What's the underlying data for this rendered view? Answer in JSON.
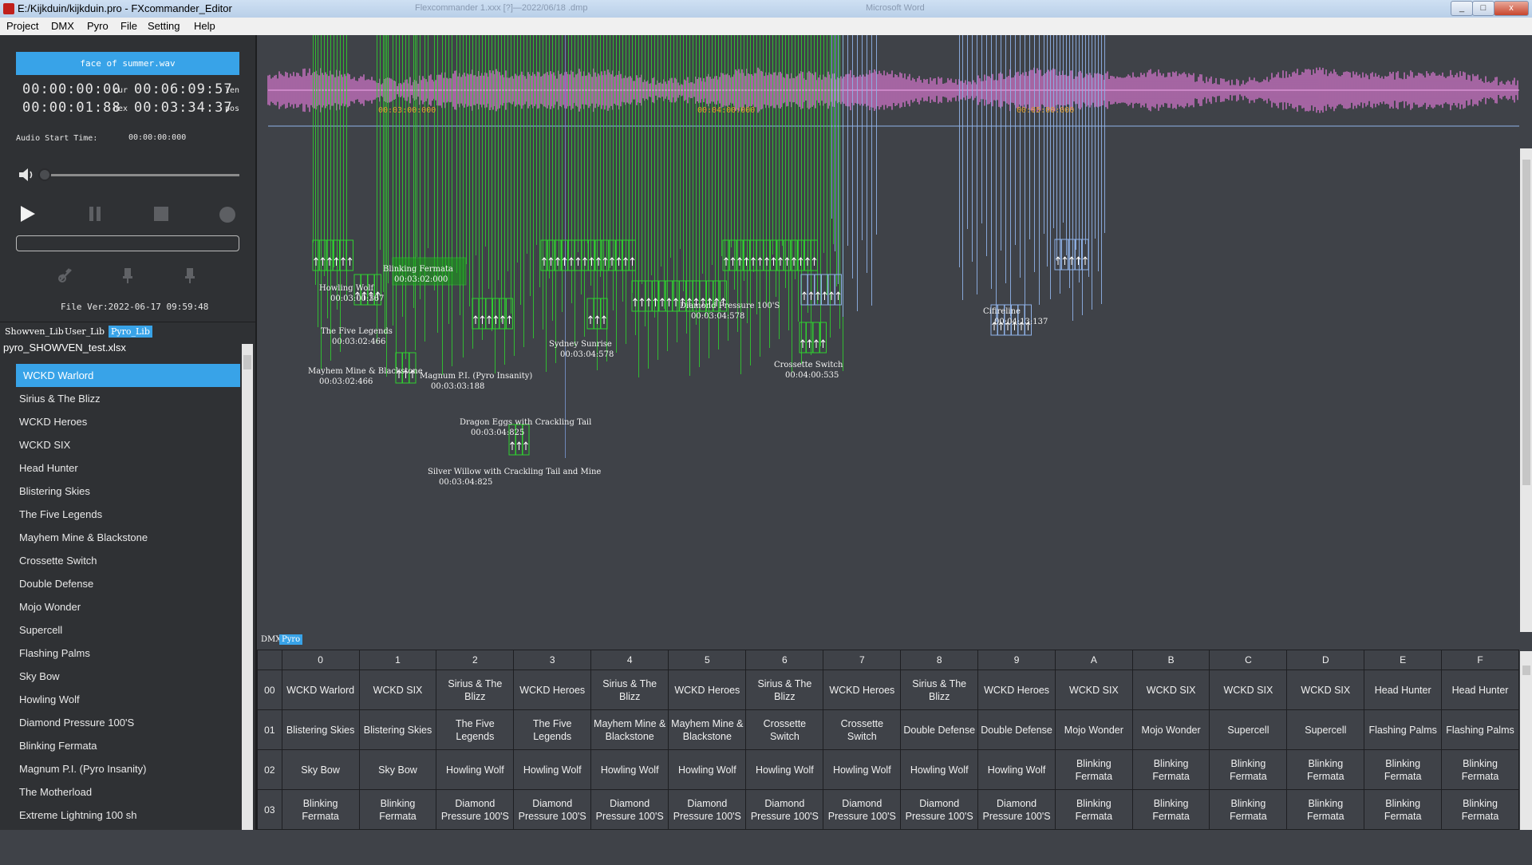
{
  "window": {
    "title": "E:/Kijkduin/kijkduin.pro - FXcommander_Editor",
    "ghost_titles": [
      "Flexcommander 1.xxx [?]—2022/06/18 .dmp",
      "Microsoft Word"
    ],
    "controls": [
      "_",
      "□",
      "x"
    ]
  },
  "menu": [
    "Project",
    "DMX",
    "Pyro",
    "File",
    "Setting",
    "Help"
  ],
  "player": {
    "audio_file": "face of summer.wav",
    "timecodes": [
      {
        "left": "00:00:00:00",
        "label_mid": "cur",
        "right": "00:06:09:57",
        "label_right": "len"
      },
      {
        "left": "00:00:01:88",
        "label_mid": "nex",
        "right": "00:03:34:37",
        "label_right": "pos"
      }
    ],
    "audio_start_label": "Audio Start Time:",
    "audio_start_value": "00:00:00:000",
    "volume": 0.0,
    "file_version": "File Ver:2022-06-17 09:59:48"
  },
  "library": {
    "tabs": [
      "Showven_Lib",
      "User_Lib",
      "Pyro_Lib"
    ],
    "active_tab": "Pyro_Lib",
    "file": "pyro_SHOWVEN_test.xlsx",
    "items": [
      "WCKD Warlord",
      "Sirius & The Blizz",
      "WCKD Heroes",
      "WCKD SIX",
      "Head Hunter",
      "Blistering Skies",
      "The Five Legends",
      "Mayhem Mine & Blackstone",
      "Crossette Switch",
      "Double Defense",
      "Mojo Wonder",
      "Supercell",
      "Flashing Palms",
      "Sky Bow",
      "Howling Wolf",
      "Diamond Pressure 100'S",
      "Blinking Fermata",
      "Magnum P.I. (Pyro Insanity)",
      "The Motherload",
      "Extreme Lightning 100 sh"
    ],
    "selected": "WCKD Warlord"
  },
  "timeline": {
    "markers": [
      "00:03:00:000",
      "00:04:00:000",
      "00:05:00:000"
    ],
    "labels": [
      {
        "text": "Blinking Fermata",
        "time": "00:03:02:000"
      },
      {
        "text": "Howling Wolf",
        "time": "00:03:00:367"
      },
      {
        "text": "The Five Legends",
        "time": "00:03:02:466"
      },
      {
        "text": "Mayhem Mine & Blackstone",
        "time": "00:03:02:466"
      },
      {
        "text": "Magnum P.I. (Pyro Insanity)",
        "time": "00:03:03:188"
      },
      {
        "text": "Dragon Eggs with Crackling Tail",
        "time": "00:03:04:825"
      },
      {
        "text": "Silver Willow with Crackling Tail and Mine",
        "time": "00:03:04:825"
      },
      {
        "text": "Sydney Sunrise",
        "time": "00:03:04:578"
      },
      {
        "text": "Diamond Pressure 100'S",
        "time": "00:03:04:578"
      },
      {
        "text": "Crossette Switch",
        "time": "00:04:00:535"
      },
      {
        "text": "Cifireline",
        "time": "00:04:13:137"
      }
    ]
  },
  "grid": {
    "tabs": [
      "DMX",
      "Pyro"
    ],
    "active_tab": "Pyro",
    "columns": [
      "0",
      "1",
      "2",
      "3",
      "4",
      "5",
      "6",
      "7",
      "8",
      "9",
      "A",
      "B",
      "C",
      "D",
      "E",
      "F"
    ],
    "rows": [
      {
        "id": "00",
        "cells": [
          "WCKD Warlord",
          "WCKD SIX",
          "Sirius & The Blizz",
          "WCKD Heroes",
          "Sirius & The Blizz",
          "WCKD Heroes",
          "Sirius & The Blizz",
          "WCKD Heroes",
          "Sirius & The Blizz",
          "WCKD Heroes",
          "WCKD SIX",
          "WCKD SIX",
          "WCKD SIX",
          "WCKD SIX",
          "Head Hunter",
          "Head Hunter"
        ]
      },
      {
        "id": "01",
        "cells": [
          "Blistering Skies",
          "Blistering Skies",
          "The Five Legends",
          "The Five Legends",
          "Mayhem Mine & Blackstone",
          "Mayhem Mine & Blackstone",
          "Crossette Switch",
          "Crossette Switch",
          "Double Defense",
          "Double Defense",
          "Mojo Wonder",
          "Mojo Wonder",
          "Supercell",
          "Supercell",
          "Flashing Palms",
          "Flashing Palms"
        ]
      },
      {
        "id": "02",
        "cells": [
          "Sky Bow",
          "Sky Bow",
          "Howling Wolf",
          "Howling Wolf",
          "Howling Wolf",
          "Howling Wolf",
          "Howling Wolf",
          "Howling Wolf",
          "Howling Wolf",
          "Howling Wolf",
          "Blinking Fermata",
          "Blinking Fermata",
          "Blinking Fermata",
          "Blinking Fermata",
          "Blinking Fermata",
          "Blinking Fermata"
        ]
      },
      {
        "id": "03",
        "cells": [
          "Blinking Fermata",
          "Blinking Fermata",
          "Diamond Pressure 100'S",
          "Diamond Pressure 100'S",
          "Diamond Pressure 100'S",
          "Diamond Pressure 100'S",
          "Diamond Pressure 100'S",
          "Diamond Pressure 100'S",
          "Diamond Pressure 100'S",
          "Diamond Pressure 100'S",
          "Blinking Fermata",
          "Blinking Fermata",
          "Blinking Fermata",
          "Blinking Fermata",
          "Blinking Fermata",
          "Blinking Fermata"
        ]
      }
    ]
  },
  "colors": {
    "accent": "#38a3e8",
    "background": "#3f4248",
    "panel": "#2f3134",
    "waveform": "#e07ad6",
    "cue_green": "#2fd12f",
    "cue_blue": "#8fb2e8",
    "marker_text": "#e0a030"
  },
  "icons": {
    "volume": "speaker-icon",
    "play": "play-icon",
    "pause": "pause-icon",
    "stop": "stop-icon",
    "record": "record-icon",
    "tools": [
      "link-off-icon",
      "pin-icon",
      "pin-icon"
    ]
  }
}
